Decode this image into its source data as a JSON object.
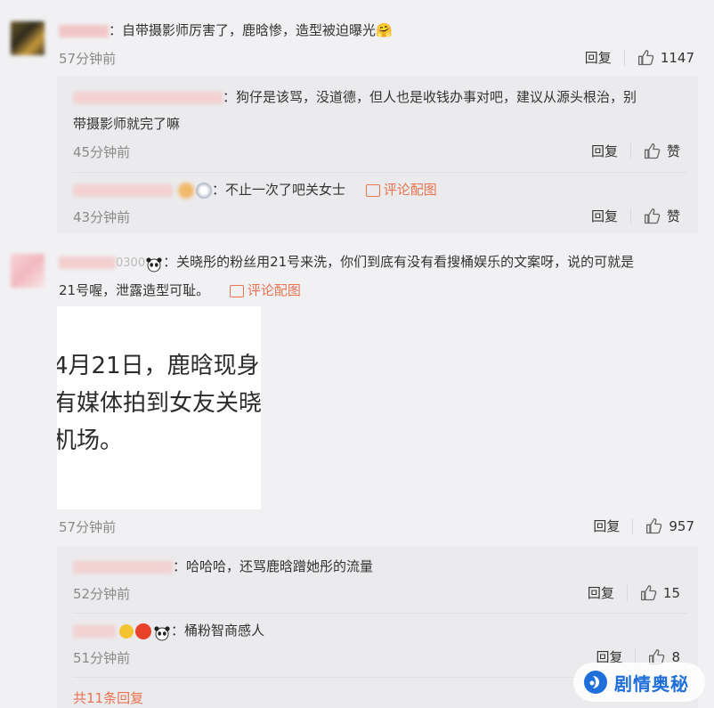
{
  "comments": [
    {
      "text": "：自带摄影师厉害了，鹿晗惨，造型被迫曝光",
      "emoji": "🤗",
      "time": "57分钟前",
      "reply_label": "回复",
      "likes": "1147"
    },
    {
      "text_line1": "：关晓彤的粉丝用21号来洗，你们到底有没有看搜桶娱乐的文案呀，说的可就是",
      "text_line2": "21号喔，泄露造型可耻。",
      "name_visible": "0300",
      "link_label": "评论配图",
      "image_lines": [
        "4月21日，鹿晗现身",
        "有媒体拍到女友关晓",
        "机场。"
      ],
      "time": "57分钟前",
      "reply_label": "回复",
      "likes": "957"
    }
  ],
  "replies_a": [
    {
      "text_line1": "：狗仔是该骂，没道德，但人也是收钱办事对吧，建议从源头根治，别",
      "text_line2": "带摄影师就完了嘛",
      "time": "45分钟前",
      "reply_label": "回复",
      "likes": "赞"
    },
    {
      "text": "：不止一次了吧关女士",
      "link_label": "评论配图",
      "time": "43分钟前",
      "reply_label": "回复",
      "likes": "赞"
    }
  ],
  "replies_b": [
    {
      "text": "：哈哈哈，还骂鹿晗蹭她彤的流量",
      "time": "52分钟前",
      "reply_label": "回复",
      "likes": "15"
    },
    {
      "text": "：桶粉智商感人",
      "time": "51分钟前",
      "reply_label": "回复",
      "likes": "8"
    }
  ],
  "more_replies": "共11条回复",
  "watermark": "剧情奥秘",
  "colors": {
    "accent": "#eb7350",
    "background": "#f1f1f3",
    "inner": "#ebebed",
    "watermark": "#1e6fd9"
  }
}
